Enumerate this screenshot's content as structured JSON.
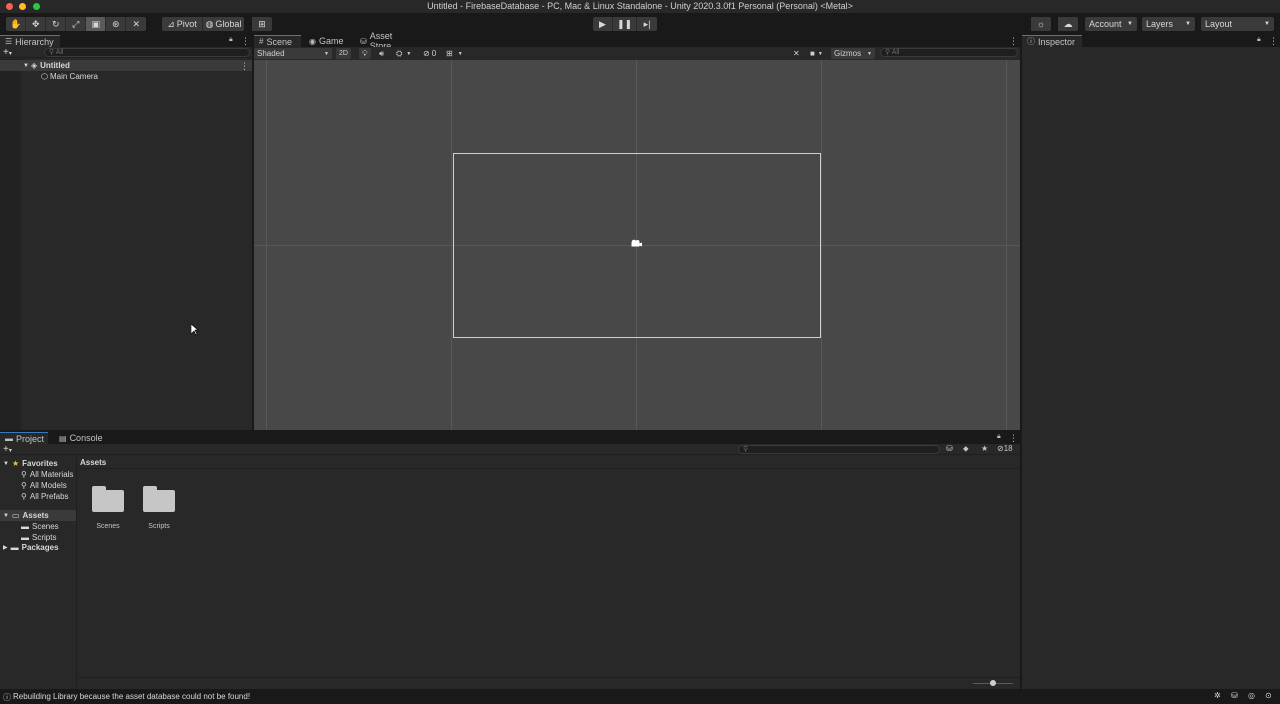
{
  "window": {
    "title": "Untitled - FirebaseDatabase - PC, Mac & Linux Standalone - Unity 2020.3.0f1 Personal (Personal) <Metal>"
  },
  "toolbar": {
    "pivot_label": "Pivot",
    "global_label": "Global",
    "account_label": "Account",
    "layers_label": "Layers",
    "layout_label": "Layout"
  },
  "hierarchy": {
    "tab_label": "Hierarchy",
    "search_placeholder": "All",
    "scene_name": "Untitled",
    "items": [
      {
        "label": "Main Camera"
      }
    ]
  },
  "scene_view": {
    "tabs": [
      {
        "label": "Scene"
      },
      {
        "label": "Game"
      },
      {
        "label": "Asset Store"
      }
    ],
    "shading_mode": "Shaded",
    "mode_2d_label": "2D",
    "hidden_count": "0",
    "gizmos_label": "Gizmos",
    "search_placeholder": "All"
  },
  "inspector": {
    "tab_label": "Inspector"
  },
  "project": {
    "tabs": [
      {
        "label": "Project"
      },
      {
        "label": "Console"
      }
    ],
    "favorites_label": "Favorites",
    "favorites": [
      {
        "label": "All Materials"
      },
      {
        "label": "All Models"
      },
      {
        "label": "All Prefabs"
      }
    ],
    "assets_label": "Assets",
    "asset_folders": [
      {
        "label": "Scenes"
      },
      {
        "label": "Scripts"
      }
    ],
    "packages_label": "Packages",
    "breadcrumb": "Assets",
    "hidden_packages_count": "18",
    "grid_items": [
      {
        "label": "Scenes"
      },
      {
        "label": "Scripts"
      }
    ]
  },
  "status": {
    "message": "Rebuilding Library because the asset database could not be found!"
  }
}
